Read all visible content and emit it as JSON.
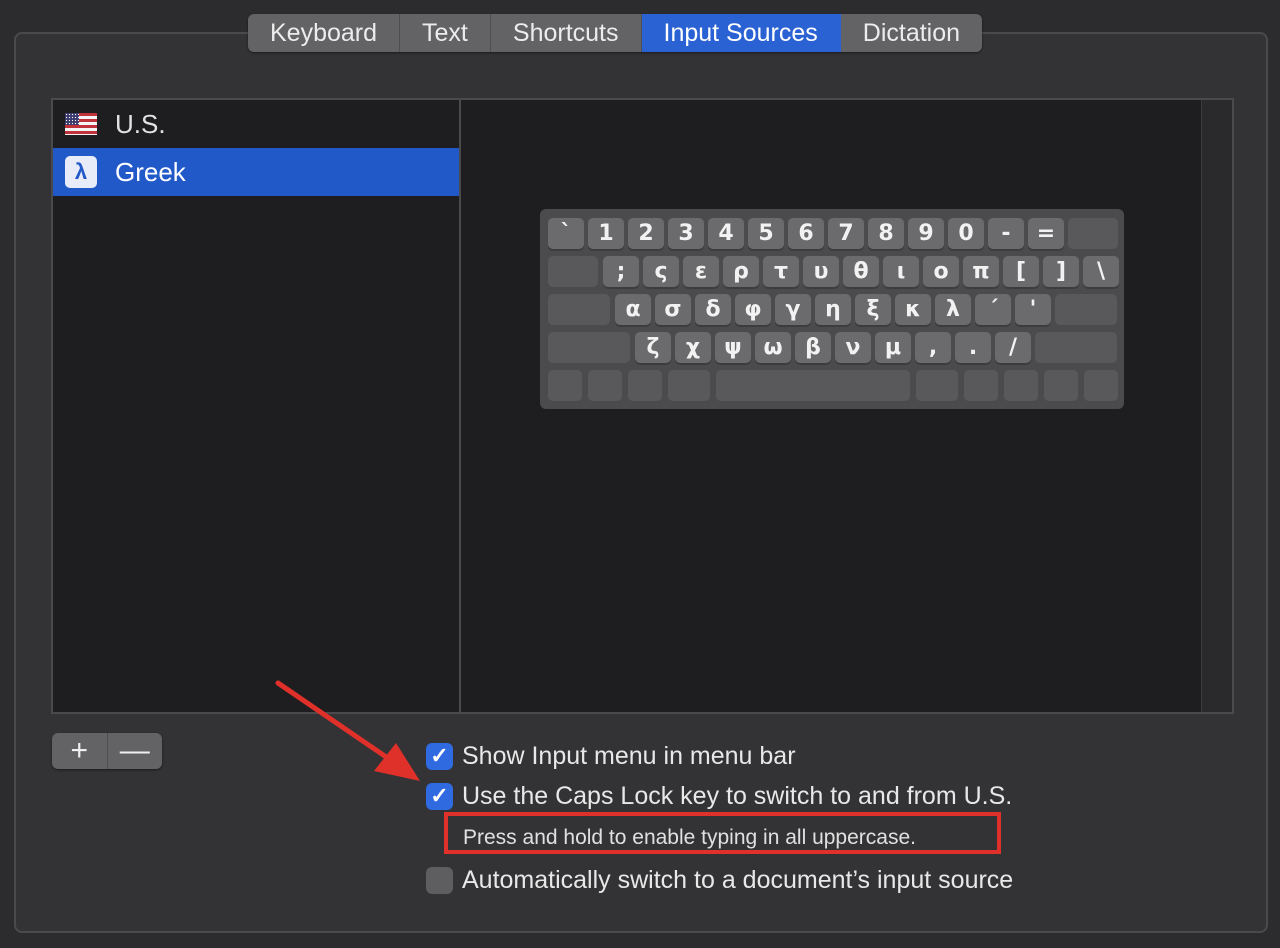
{
  "tabs": [
    {
      "label": "Keyboard",
      "active": false
    },
    {
      "label": "Text",
      "active": false
    },
    {
      "label": "Shortcuts",
      "active": false
    },
    {
      "label": "Input Sources",
      "active": true
    },
    {
      "label": "Dictation",
      "active": false
    }
  ],
  "input_sources": [
    {
      "label": "U.S.",
      "icon": "us-flag-icon",
      "selected": false
    },
    {
      "label": "Greek",
      "icon": "greek-lambda-icon",
      "icon_glyph": "λ",
      "selected": true
    }
  ],
  "keyboard": {
    "row1": [
      "`",
      "1",
      "2",
      "3",
      "4",
      "5",
      "6",
      "7",
      "8",
      "9",
      "0",
      "-",
      "="
    ],
    "row2": [
      ";",
      "ς",
      "ε",
      "ρ",
      "τ",
      "υ",
      "θ",
      "ι",
      "ο",
      "π",
      "[",
      "]",
      "\\"
    ],
    "row3": [
      "α",
      "σ",
      "δ",
      "φ",
      "γ",
      "η",
      "ξ",
      "κ",
      "λ",
      "΄",
      "'"
    ],
    "row4": [
      "ζ",
      "χ",
      "ψ",
      "ω",
      "β",
      "ν",
      "μ",
      ",",
      ".",
      "/"
    ]
  },
  "list_controls": {
    "add": "+",
    "remove": "—"
  },
  "options": {
    "show_input_menu": {
      "label": "Show Input menu in menu bar",
      "checked": true
    },
    "caps_lock_switch": {
      "label": "Use the Caps Lock key to switch to and from U.S.",
      "checked": true
    },
    "caps_lock_hint": "Press and hold to enable typing in all uppercase.",
    "auto_switch": {
      "label": "Automatically switch to a document’s input source",
      "checked": false
    }
  },
  "colors": {
    "accent": "#2159c9",
    "annotation": "#e0302a"
  }
}
